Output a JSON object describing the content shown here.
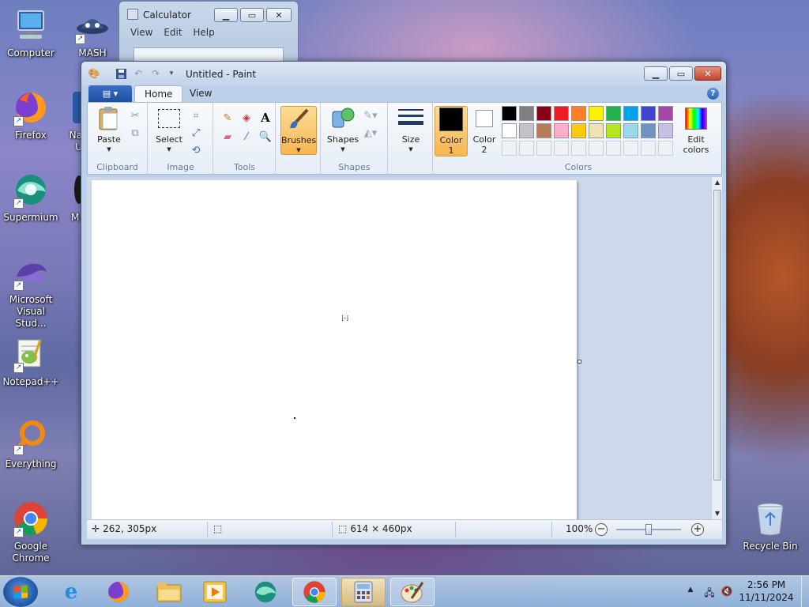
{
  "desktop": {
    "icons": [
      {
        "label": "Computer",
        "icon": "computer-icon"
      },
      {
        "label": "MASH",
        "icon": "mash-icon"
      },
      {
        "label": "Firefox",
        "icon": "firefox-icon"
      },
      {
        "label": "Na U",
        "icon": "app-icon"
      },
      {
        "label": "Supermium",
        "icon": "supermium-icon"
      },
      {
        "label": "M",
        "icon": "app-icon"
      },
      {
        "label": "Microsoft Visual Stud...",
        "icon": "visual-studio-icon"
      },
      {
        "label": "Notepad++",
        "icon": "notepad-plus-plus-icon"
      },
      {
        "label": "Everything",
        "icon": "everything-icon"
      },
      {
        "label": "Google Chrome",
        "icon": "chrome-icon"
      },
      {
        "label": "Recycle Bin",
        "icon": "recycle-bin-icon"
      }
    ]
  },
  "calculator": {
    "title": "Calculator",
    "menu": [
      "View",
      "Edit",
      "Help"
    ]
  },
  "paint": {
    "title": "Untitled - Paint",
    "tabs": {
      "home": "Home",
      "view": "View"
    },
    "help": "?",
    "ribbon": {
      "clipboard": {
        "label": "Clipboard",
        "paste": "Paste"
      },
      "image": {
        "label": "Image",
        "select": "Select"
      },
      "tools": {
        "label": "Tools"
      },
      "brushes": "Brushes",
      "shapes": {
        "label": "Shapes",
        "button": "Shapes"
      },
      "size": "Size",
      "colors": {
        "label": "Colors",
        "color1": "Color 1",
        "color2": "Color 2",
        "edit": "Edit colors",
        "color1_value": "#000000",
        "color2_value": "#ffffff",
        "palette_row1": [
          "#000000",
          "#7f7f7f",
          "#880015",
          "#ed1c24",
          "#ff7f27",
          "#fff200",
          "#22b14c",
          "#00a2e8",
          "#3f48cc",
          "#a349a4"
        ],
        "palette_row2": [
          "#ffffff",
          "#c3c3c3",
          "#b97a57",
          "#ffaec9",
          "#ffc90e",
          "#efe4b0",
          "#b5e61d",
          "#99d9ea",
          "#7092be",
          "#c8bfe7"
        ]
      }
    },
    "status": {
      "cursor_pos": "262, 305px",
      "selection": "",
      "image_size": "614 × 460px",
      "zoom": "100%"
    },
    "zoom_level_fraction": 0.5
  },
  "taskbar": {
    "time": "2:56 PM",
    "date": "11/11/2024",
    "items": [
      "internet-explorer",
      "firefox",
      "file-explorer",
      "media-player",
      "supermium",
      "chrome",
      "calculator",
      "paint"
    ]
  }
}
